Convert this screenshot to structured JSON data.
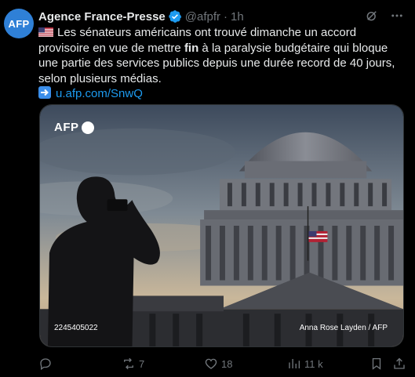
{
  "author": {
    "avatar_text": "AFP",
    "name": "Agence France-Presse",
    "handle": "@afpfr",
    "separator": "·",
    "time": "1h"
  },
  "tweet": {
    "text_before_bold": "Les sénateurs américains ont trouvé dimanche un accord provisoire en vue de mettre ",
    "bold_word": "fin",
    "text_after_bold": " à la paralysie budgétaire qui bloque une partie des services publics depuis une durée record de 40 jours, selon plusieurs médias.",
    "link": "u.afp.com/SnwQ"
  },
  "media": {
    "logo_text": "AFP",
    "photo_id": "2245405022",
    "credit": "Anna Rose Layden / AFP"
  },
  "actions": {
    "replies": "",
    "retweets": "7",
    "likes": "18",
    "views": "11 k"
  },
  "colors": {
    "background": "#000000",
    "link": "#1d9bf0",
    "muted": "#71767b",
    "avatar": "#2f80d7"
  }
}
